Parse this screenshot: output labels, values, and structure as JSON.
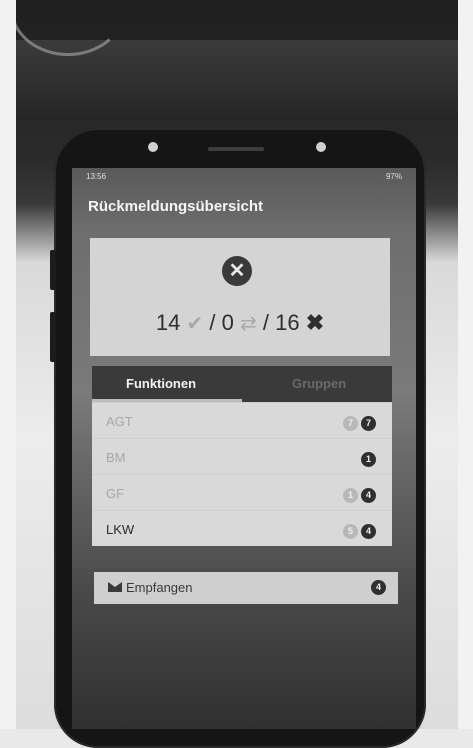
{
  "status_bar": {
    "time": "13:56",
    "right": "97%"
  },
  "app": {
    "title": "Rückmeldungsübersicht"
  },
  "summary": {
    "status_icon": "x-circle-icon",
    "confirmed": "14",
    "neutral": "0",
    "declined": "16"
  },
  "tabs": [
    {
      "label": "Funktionen",
      "active": true
    },
    {
      "label": "Gruppen",
      "active": false
    }
  ],
  "rows": [
    {
      "label": "AGT",
      "badges": [
        "7",
        "7"
      ]
    },
    {
      "label": "BM",
      "badges": [
        "1"
      ]
    },
    {
      "label": "GF",
      "badges": [
        "1",
        "4"
      ]
    },
    {
      "label": "LKW",
      "badges": [
        "5",
        "4"
      ]
    }
  ],
  "received": {
    "label": "Empfangen",
    "count": "4",
    "icon": "envelope-icon"
  }
}
